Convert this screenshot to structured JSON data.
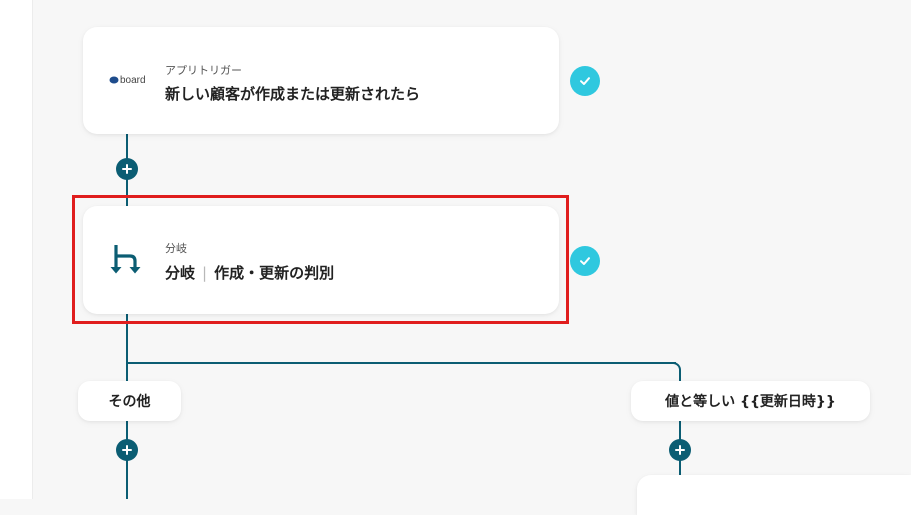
{
  "colors": {
    "accent": "#0b5d73",
    "check": "#2fc8df",
    "highlight": "#e01e1e"
  },
  "trigger_card": {
    "logo_text": "board",
    "sub": "アプリトリガー",
    "title": "新しい顧客が作成または更新されたら"
  },
  "branch_card": {
    "icon": "branch-icon",
    "sub": "分岐",
    "title_prefix": "分岐",
    "separator": "|",
    "title_rest": "作成・更新の判別"
  },
  "branches": {
    "left_label": "その他",
    "right_label": "値と等しい {{更新日時}}"
  }
}
